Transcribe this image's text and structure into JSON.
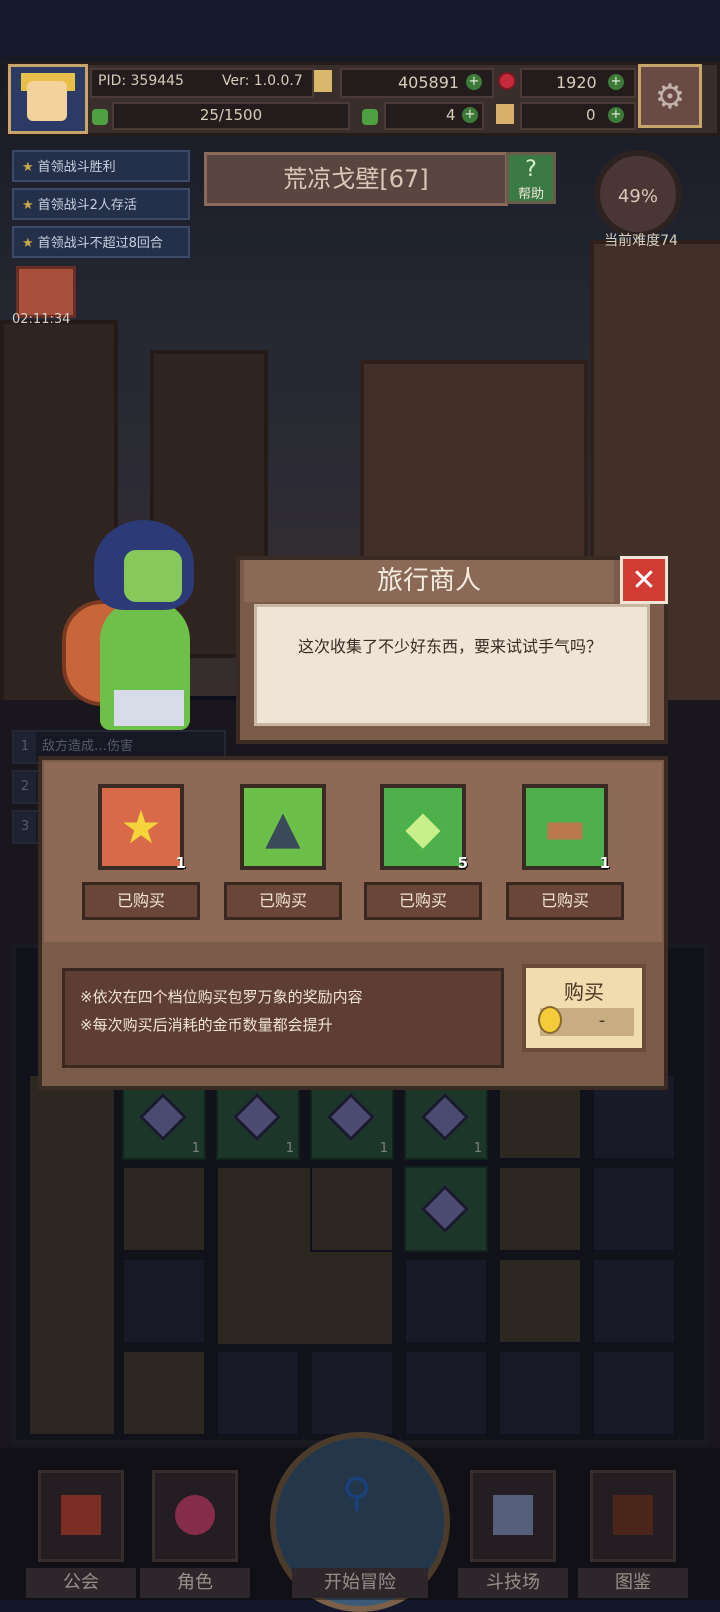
{
  "hud": {
    "pid": "PID: 359445",
    "version": "Ver: 1.0.0.7",
    "gold": "405891",
    "gems": "1920",
    "energy": "25/1500",
    "clovers": "4",
    "keys": "0"
  },
  "quests": [
    "首领战斗胜利",
    "首领战斗2人存活",
    "首领战斗不超过8回合"
  ],
  "gift_timer": "02:11:34",
  "region": {
    "name": "荒凉戈壁[67]",
    "help_label": "帮助"
  },
  "difficulty": {
    "percent": "49%",
    "label": "当前难度74"
  },
  "combat_log": {
    "row1_num": "1",
    "row1_text": "敌方造成…伤害",
    "row2_num": "2",
    "row3_num": "3"
  },
  "dialog": {
    "title": "旅行商人",
    "close_icon": "close-icon",
    "message": "这次收集了不少好东西，要来试试手气吗？"
  },
  "shop": {
    "items": [
      {
        "icon": "star-icon",
        "glyph": "★",
        "count": "1",
        "status": "已购买",
        "bg": "#d86a4a"
      },
      {
        "icon": "wizard-hat-icon",
        "glyph": "▲",
        "count": "",
        "status": "已购买",
        "bg": "#6cc04a"
      },
      {
        "icon": "green-gem-icon",
        "glyph": "◆",
        "count": "5",
        "status": "已购买",
        "bg": "#4eb04a"
      },
      {
        "icon": "crate-icon",
        "glyph": "▬",
        "count": "1",
        "status": "已购买",
        "bg": "#4eb04a"
      }
    ],
    "info_lines": [
      "※依次在四个档位购买包罗万象的奖励内容",
      "※每次购买后消耗的金币数量都会提升"
    ],
    "buy_label": "购买",
    "price": "-"
  },
  "inventory": {
    "counts": [
      "1",
      "1",
      "1",
      "1"
    ]
  },
  "nav": {
    "guild": "公会",
    "character": "角色",
    "start": "开始冒险",
    "arena": "斗技场",
    "codex": "图鉴"
  },
  "colors": {
    "panel": "#7a5a48",
    "accent_red": "#d23a34",
    "buy_button": "#f0dcae"
  }
}
